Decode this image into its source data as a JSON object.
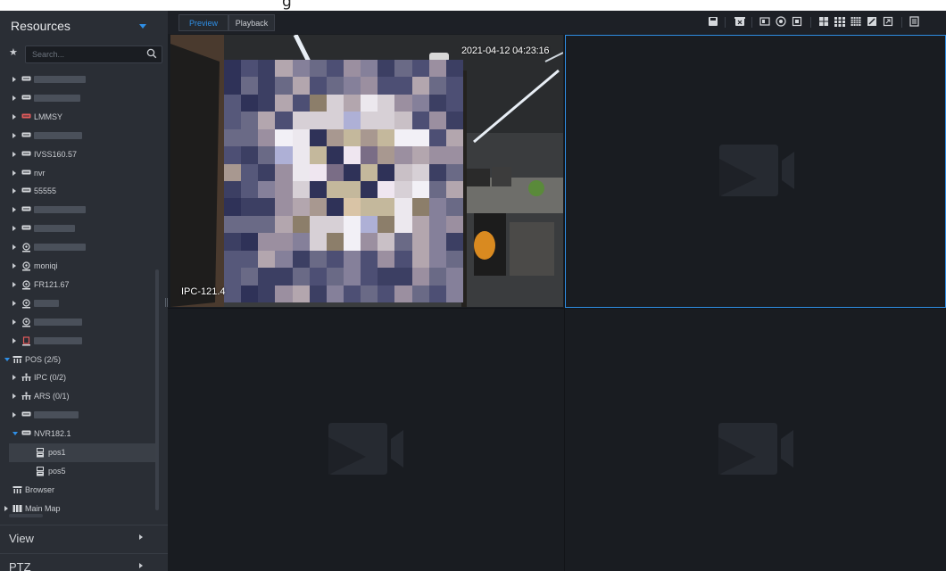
{
  "caption": "g",
  "resources": {
    "title": "Resources",
    "search_placeholder": "Search...",
    "tree": [
      {
        "label": "",
        "type": "device",
        "state": "collapsed"
      },
      {
        "label": "",
        "type": "device",
        "state": "collapsed"
      },
      {
        "label": "LMMSY",
        "type": "device-red",
        "state": "collapsed"
      },
      {
        "label": "",
        "type": "device",
        "state": "collapsed"
      },
      {
        "label": "IVSS160.57",
        "type": "device",
        "state": "collapsed"
      },
      {
        "label": "nvr",
        "type": "device",
        "state": "collapsed"
      },
      {
        "label": "55555",
        "type": "device",
        "state": "collapsed"
      },
      {
        "label": "",
        "type": "device",
        "state": "collapsed"
      },
      {
        "label": "",
        "type": "device",
        "state": "collapsed"
      },
      {
        "label": "",
        "type": "camera",
        "state": "collapsed"
      },
      {
        "label": "moniqi",
        "type": "camera",
        "state": "collapsed"
      },
      {
        "label": "FR121.67",
        "type": "camera",
        "state": "collapsed"
      },
      {
        "label": "",
        "type": "camera",
        "state": "collapsed"
      },
      {
        "label": "",
        "type": "camera",
        "state": "collapsed"
      },
      {
        "label": "",
        "type": "alarm",
        "state": "collapsed"
      },
      {
        "label": "POS (2/5)",
        "type": "group",
        "state": "expanded"
      },
      {
        "label": "IPC (0/2)",
        "type": "org",
        "state": "collapsed"
      },
      {
        "label": "ARS (0/1)",
        "type": "org",
        "state": "collapsed"
      },
      {
        "label": "",
        "type": "device",
        "state": "collapsed"
      },
      {
        "label": "NVR182.1",
        "type": "device",
        "state": "expanded"
      },
      {
        "label": "pos1",
        "type": "pos",
        "state": "leaf",
        "selected": true
      },
      {
        "label": "pos5",
        "type": "pos",
        "state": "leaf"
      },
      {
        "label": "Browser",
        "type": "group",
        "state": "leaf"
      },
      {
        "label": "Main Map",
        "type": "map",
        "state": "collapsed"
      }
    ],
    "accordions": [
      "View",
      "PTZ"
    ]
  },
  "main": {
    "tabs": [
      {
        "label": "Preview",
        "active": true
      },
      {
        "label": "Playback",
        "active": false
      }
    ],
    "toolbar_icons": [
      "save-icon",
      "delete-icon",
      "stream-icon",
      "record-icon",
      "fullwindow-icon",
      "layout-4-icon",
      "layout-9-icon",
      "layout-16-icon",
      "custom-layout-icon",
      "fullscreen-icon",
      "menu-icon"
    ],
    "cells": [
      {
        "type": "video",
        "timestamp": "2021-04-12 04:23:16",
        "camera_name": "IPC-121.4"
      },
      {
        "type": "empty",
        "active": true
      },
      {
        "type": "empty"
      },
      {
        "type": "empty"
      }
    ]
  },
  "colors": {
    "accent": "#2f8fe6",
    "panel": "#2a2e35",
    "viewport": "#191c21"
  }
}
